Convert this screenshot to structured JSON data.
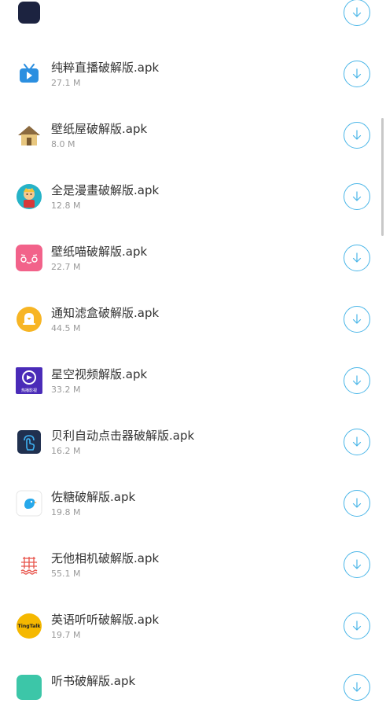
{
  "files": [
    {
      "name": "",
      "size": "",
      "icon": "partial-top-icon"
    },
    {
      "name": "纯粹直播破解版.apk",
      "size": "27.1 M",
      "icon": "tv-icon"
    },
    {
      "name": "壁纸屋破解版.apk",
      "size": "8.0 M",
      "icon": "house-icon"
    },
    {
      "name": "全是漫畫破解版.apk",
      "size": "12.8 M",
      "icon": "comic-character-icon"
    },
    {
      "name": "壁纸喵破解版.apk",
      "size": "22.7 M",
      "icon": "cat-face-icon"
    },
    {
      "name": "通知滤盒破解版.apk",
      "size": "44.5 M",
      "icon": "bell-icon"
    },
    {
      "name": "星空视频解版.apk",
      "size": "33.2 M",
      "icon": "starry-video-icon"
    },
    {
      "name": "贝利自动点击器破解版.apk",
      "size": "16.2 M",
      "icon": "tap-finger-icon"
    },
    {
      "name": "佐糖破解版.apk",
      "size": "19.8 M",
      "icon": "candy-bird-icon"
    },
    {
      "name": "无他相机破解版.apk",
      "size": "55.1 M",
      "icon": "camera-grid-icon"
    },
    {
      "name": "英语听听破解版.apk",
      "size": "19.7 M",
      "icon": "tingting-icon"
    },
    {
      "name": "听书破解版.apk",
      "size": "",
      "icon": "partial-bottom-icon"
    }
  ],
  "icon_text": {
    "starry": "热播影视",
    "tingting": "TingTalk"
  },
  "colors": {
    "accent": "#4ab6e8",
    "text": "#333333",
    "subtext": "#9a9a9a"
  }
}
